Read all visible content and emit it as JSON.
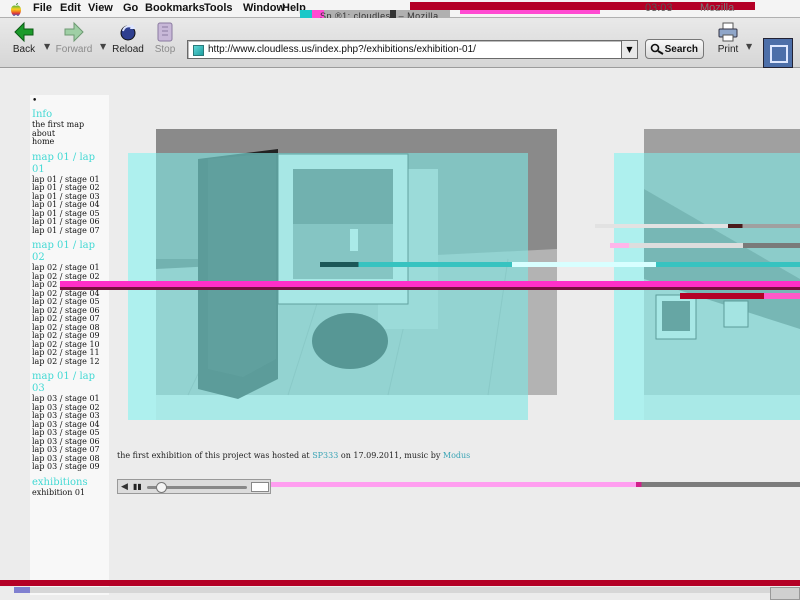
{
  "menubar": {
    "items": [
      "File",
      "Edit",
      "View",
      "Go",
      "Bookmarks",
      "Tools",
      "Window",
      "Help"
    ],
    "clock": "03:03",
    "app_name": "Mozilla",
    "window_title": "Sp ®1: cloudless – Mozilla"
  },
  "toolbar": {
    "back": "Back",
    "forward": "Forward",
    "reload": "Reload",
    "stop": "Stop",
    "url": "http://www.cloudless.us/index.php?/exhibitions/exhibition-01/",
    "search": "Search",
    "print": "Print"
  },
  "sidebar": {
    "dot": "•",
    "info": {
      "title": "Info",
      "items": [
        "the first map",
        "about",
        "home"
      ]
    },
    "lap01": {
      "title": "map 01 / lap 01",
      "items": [
        "lap 01 / stage 01",
        "lap 01 / stage 02",
        "lap 01 / stage 03",
        "lap 01 / stage 04",
        "lap 01 / stage 05",
        "lap 01 / stage 06",
        "lap 01 / stage 07"
      ]
    },
    "lap02": {
      "title": "map 01 / lap 02",
      "items": [
        "lap 02 / stage 01",
        "lap 02 / stage 02",
        "lap 02 / stage 03",
        "lap 02 / stage 04",
        "lap 02 / stage 05",
        "lap 02 / stage 06",
        "lap 02 / stage 07",
        "lap 02 / stage 08",
        "lap 02 / stage 09",
        "lap 02 / stage 10",
        "lap 02 / stage 11",
        "lap 02 / stage 12"
      ]
    },
    "lap03": {
      "title": "map 01 / lap 03",
      "items": [
        "lap 03 / stage 01",
        "lap 03 / stage 02",
        "lap 03 / stage 03",
        "lap 03 / stage 04",
        "lap 03 / stage 05",
        "lap 03 / stage 06",
        "lap 03 / stage 07",
        "lap 03 / stage 08",
        "lap 03 / stage 09"
      ]
    },
    "exhibitions": {
      "title": "exhibitions",
      "items": [
        "exhibition 01"
      ]
    }
  },
  "caption": {
    "before": "the first exhibition of this project was hosted at ",
    "venue": "SP333",
    "middle": " on 17.09.2011, music by ",
    "artist": "Modus"
  },
  "colors": {
    "sidebar_heading": "#43d9d4",
    "link": "#3aa4b5",
    "photo_tint": "#7fe6e4",
    "glitch_magenta": "#ff2fc8",
    "glitch_red": "#b40026"
  }
}
